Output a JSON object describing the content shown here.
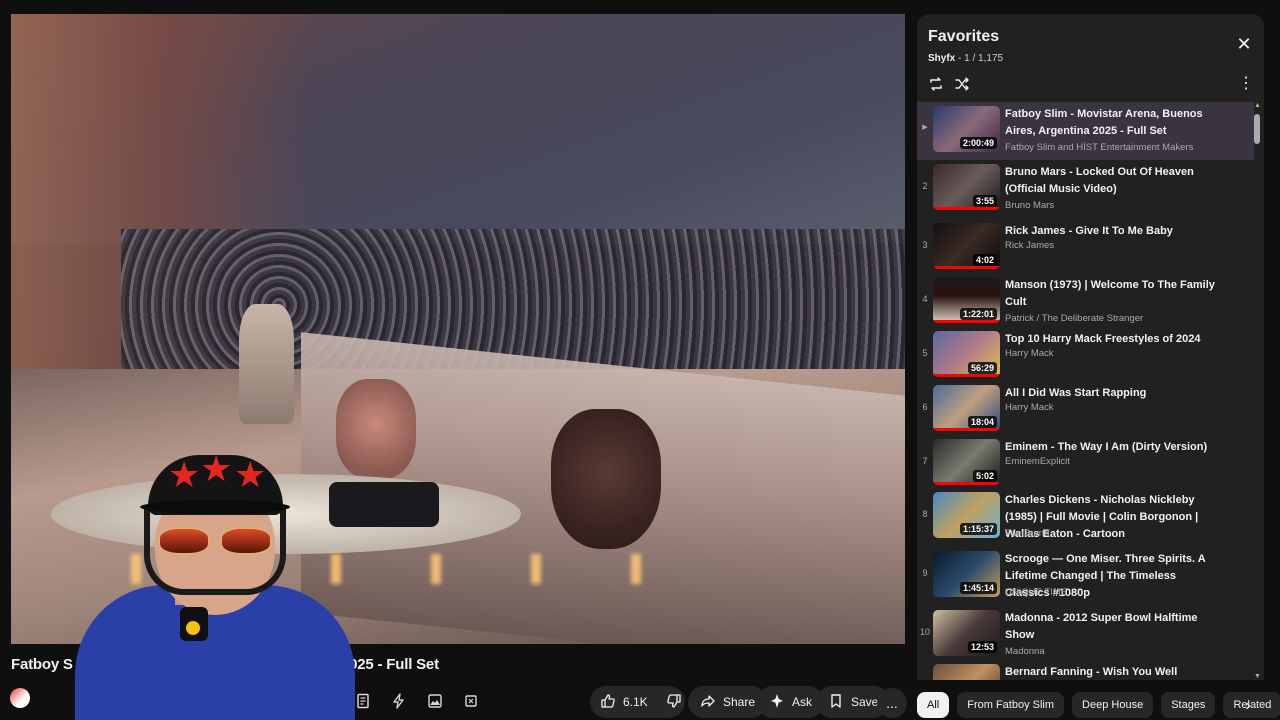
{
  "video": {
    "title_start": "Fatboy S",
    "title_end": "2025 - Full Set"
  },
  "actions": {
    "likes": "6.1K",
    "share": "Share",
    "ask": "Ask",
    "save": "Save",
    "more": "..."
  },
  "playlist": {
    "title": "Favorites",
    "owner": "Shyfx",
    "position": "- 1 / 1,175",
    "items": [
      {
        "index": "▶",
        "title": "Fatboy Slim - Movistar Arena, Buenos Aires, Argentina 2025 - Full Set",
        "channel": "Fatboy Slim and HÍST Entertainment Makers",
        "duration": "2:00:49",
        "active": true,
        "progress": 0
      },
      {
        "index": "2",
        "title": "Bruno Mars - Locked Out Of Heaven (Official Music Video)",
        "channel": "Bruno Mars",
        "duration": "3:55",
        "progress": 1.0
      },
      {
        "index": "3",
        "title": "Rick James - Give It To Me Baby",
        "channel": "Rick James",
        "duration": "4:02",
        "progress": 1.0
      },
      {
        "index": "4",
        "title": "Manson (1973) | Welcome To The Family Cult",
        "channel": "Patrick / The Deliberate Stranger",
        "duration": "1:22:01",
        "progress": 1.0
      },
      {
        "index": "5",
        "title": "Top 10 Harry Mack Freestyles of 2024",
        "channel": "Harry Mack",
        "duration": "56:29",
        "progress": 1.0
      },
      {
        "index": "6",
        "title": "All I Did Was Start Rapping",
        "channel": "Harry Mack",
        "duration": "18:04",
        "progress": 1.0
      },
      {
        "index": "7",
        "title": "Eminem - The Way I Am (Dirty Version)",
        "channel": "EminemExplicit",
        "duration": "5:02",
        "progress": 1.0
      },
      {
        "index": "8",
        "title": "Charles Dickens - Nicholas Nickleby (1985) | Full Movie | Colin Borgonon | Wallas Eaton - Cartoon",
        "channel": "FamBrand",
        "duration": "1:15:37",
        "progress": 0
      },
      {
        "index": "9",
        "title": "Scrooge — One Miser. Three Spirits. A Lifetime Changed | The Timeless Classics #1080p",
        "channel": "UNIQUE TIME",
        "duration": "1:45:14",
        "progress": 0
      },
      {
        "index": "10",
        "title": "Madonna - 2012 Super Bowl Halftime Show",
        "channel": "Madonna",
        "duration": "12:53",
        "progress": 0
      },
      {
        "index": "11",
        "title": "Bernard Fanning - Wish You Well",
        "channel": "",
        "duration": "",
        "progress": 0
      }
    ]
  },
  "chips": [
    "All",
    "From Fatboy Slim",
    "Deep House",
    "Stages",
    "Related"
  ],
  "colors": {
    "background": "#0f0f0f",
    "panel": "#212121",
    "active_row": "#3a3340",
    "progress": "#ff0000"
  }
}
